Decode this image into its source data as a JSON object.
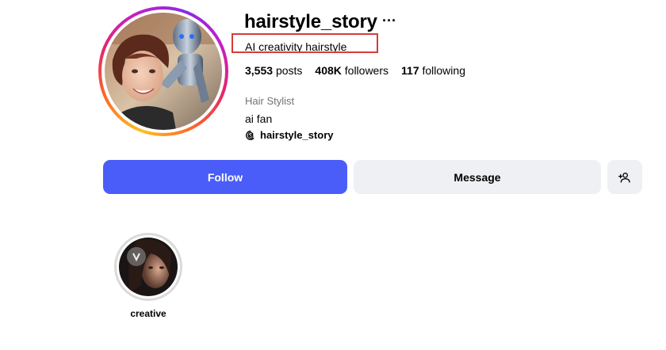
{
  "profile": {
    "username": "hairstyle_story",
    "more_icon": "more-horizontal-icon",
    "tagline": "AI creativity hairstyle",
    "stats": {
      "posts_count": "3,553",
      "posts_label": "posts",
      "followers_count": "408K",
      "followers_label": "followers",
      "following_count": "117",
      "following_label": "following"
    },
    "category": "Hair Stylist",
    "bio": "ai fan",
    "threads_handle": "hairstyle_story",
    "threads_icon": "threads-icon"
  },
  "actions": {
    "follow_label": "Follow",
    "message_label": "Message",
    "suggest_icon": "add-person-icon"
  },
  "highlights": [
    {
      "label": "creative"
    }
  ],
  "colors": {
    "follow_bg": "#4a5df9",
    "secondary_bg": "#eff0f3",
    "annotation_red": "#d93a3a"
  }
}
